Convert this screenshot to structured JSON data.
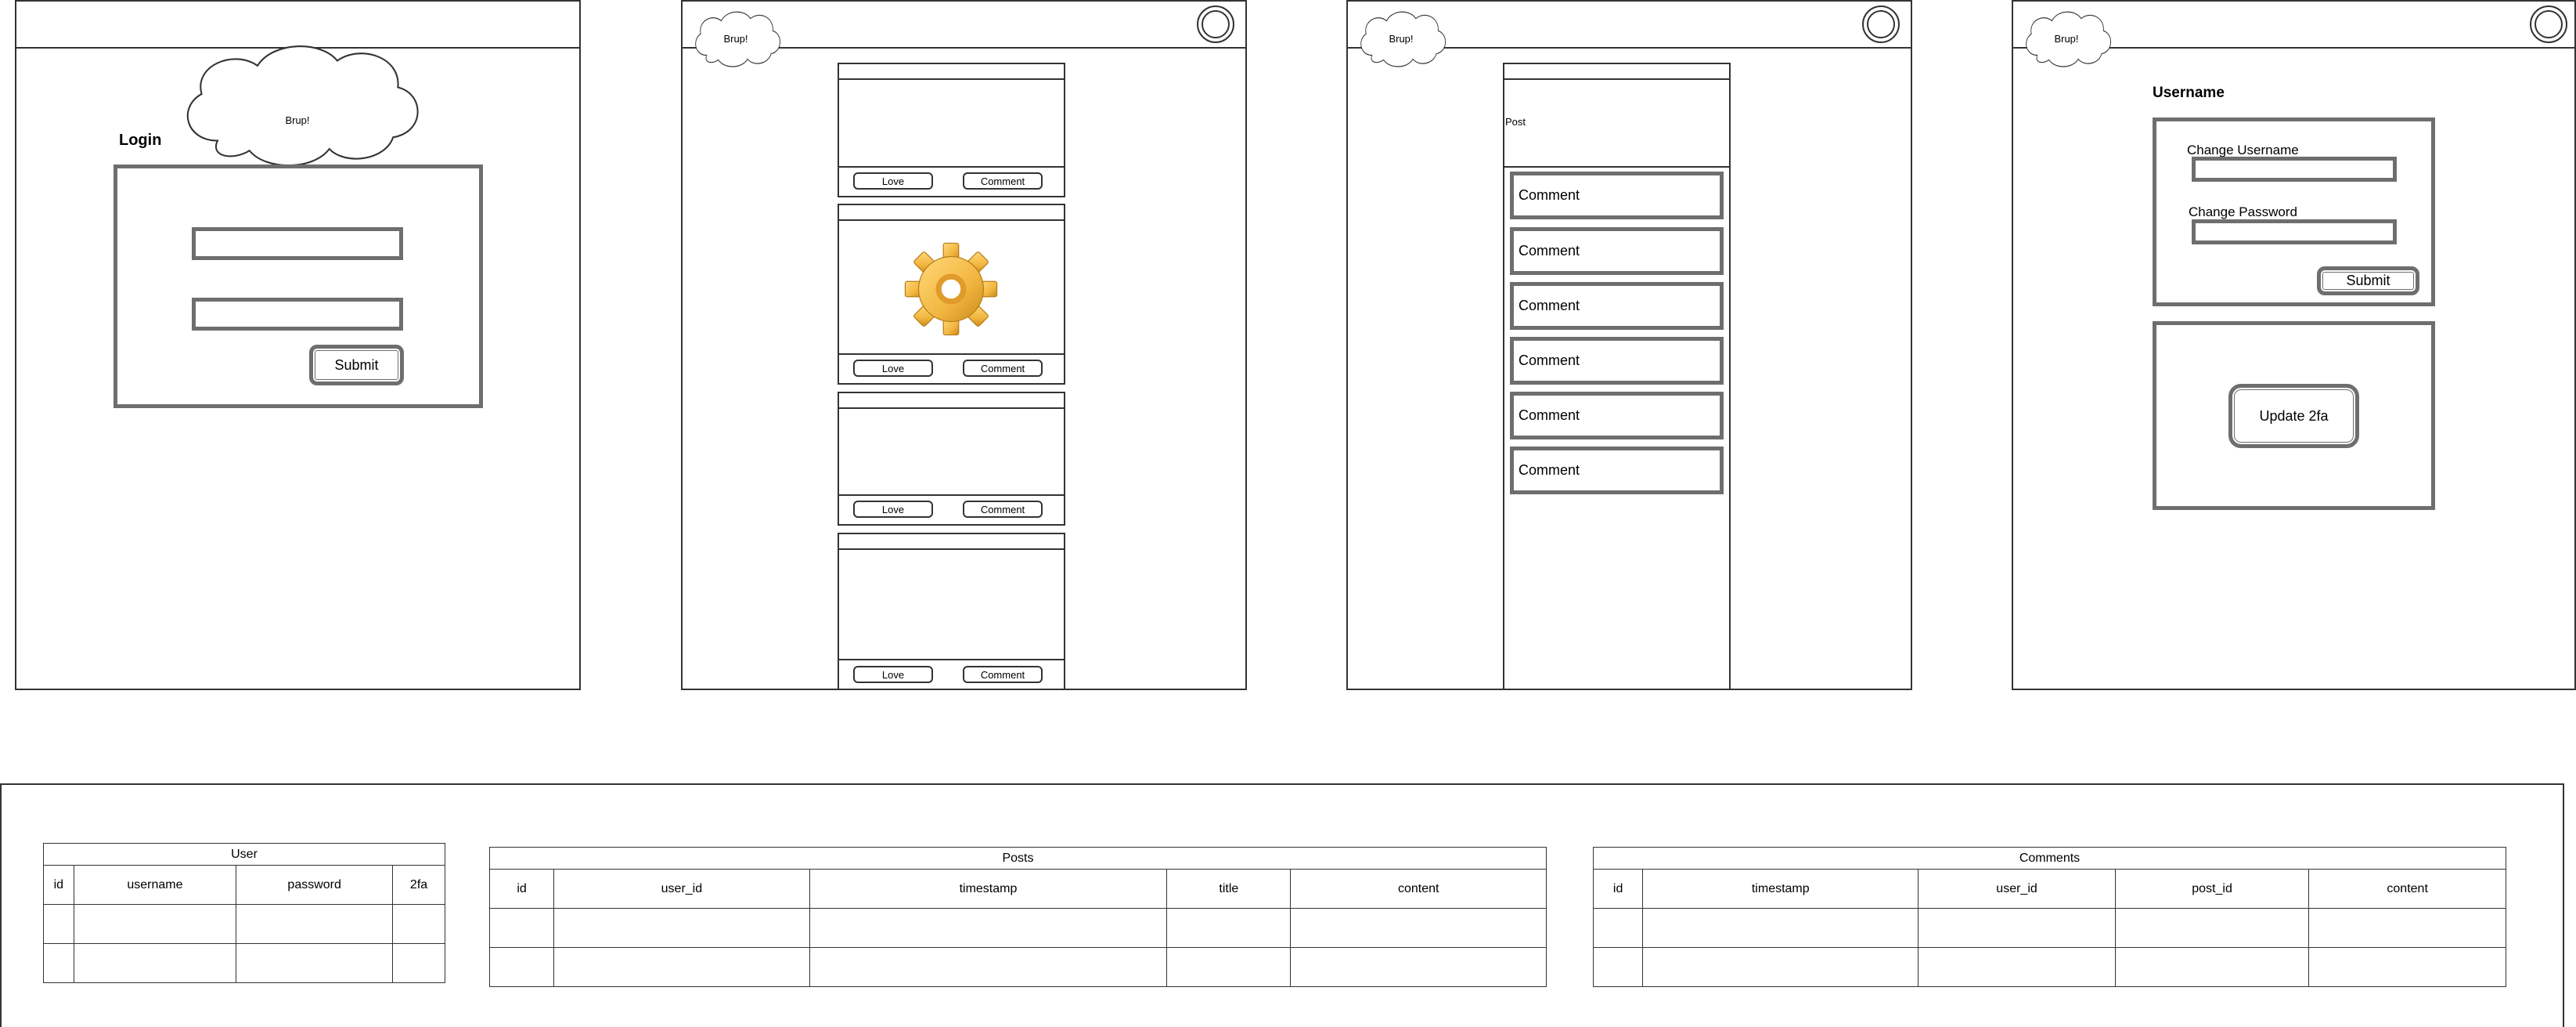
{
  "app": {
    "brand": "Brup!"
  },
  "login": {
    "title": "Login",
    "submit_label": "Submit"
  },
  "feed": {
    "posts": [
      {
        "love": "Love",
        "comment": "Comment",
        "has_image": false
      },
      {
        "love": "Love",
        "comment": "Comment",
        "has_image": true,
        "image_icon": "gear-icon"
      },
      {
        "love": "Love",
        "comment": "Comment",
        "has_image": false
      },
      {
        "love": "Love",
        "comment": "Comment",
        "has_image": false
      }
    ]
  },
  "post_view": {
    "post_label": "Post",
    "comments": [
      "Comment",
      "Comment",
      "Comment",
      "Comment",
      "Comment",
      "Comment"
    ]
  },
  "settings": {
    "heading": "Username",
    "change_username_label": "Change Username",
    "change_password_label": "Change Password",
    "submit_label": "Submit",
    "update_2fa_label": "Update 2fa"
  },
  "schema": {
    "user": {
      "title": "User",
      "columns": [
        "id",
        "username",
        "password",
        "2fa"
      ],
      "empty_rows": 2
    },
    "posts": {
      "title": "Posts",
      "columns": [
        "id",
        "user_id",
        "timestamp",
        "title",
        "content"
      ],
      "empty_rows": 2
    },
    "comments": {
      "title": "Comments",
      "columns": [
        "id",
        "timestamp",
        "user_id",
        "post_id",
        "content"
      ],
      "empty_rows": 2
    }
  },
  "colors": {
    "frame": "#333333",
    "thick_border": "#6e6e6e",
    "gear_fill": "#f2b640"
  }
}
